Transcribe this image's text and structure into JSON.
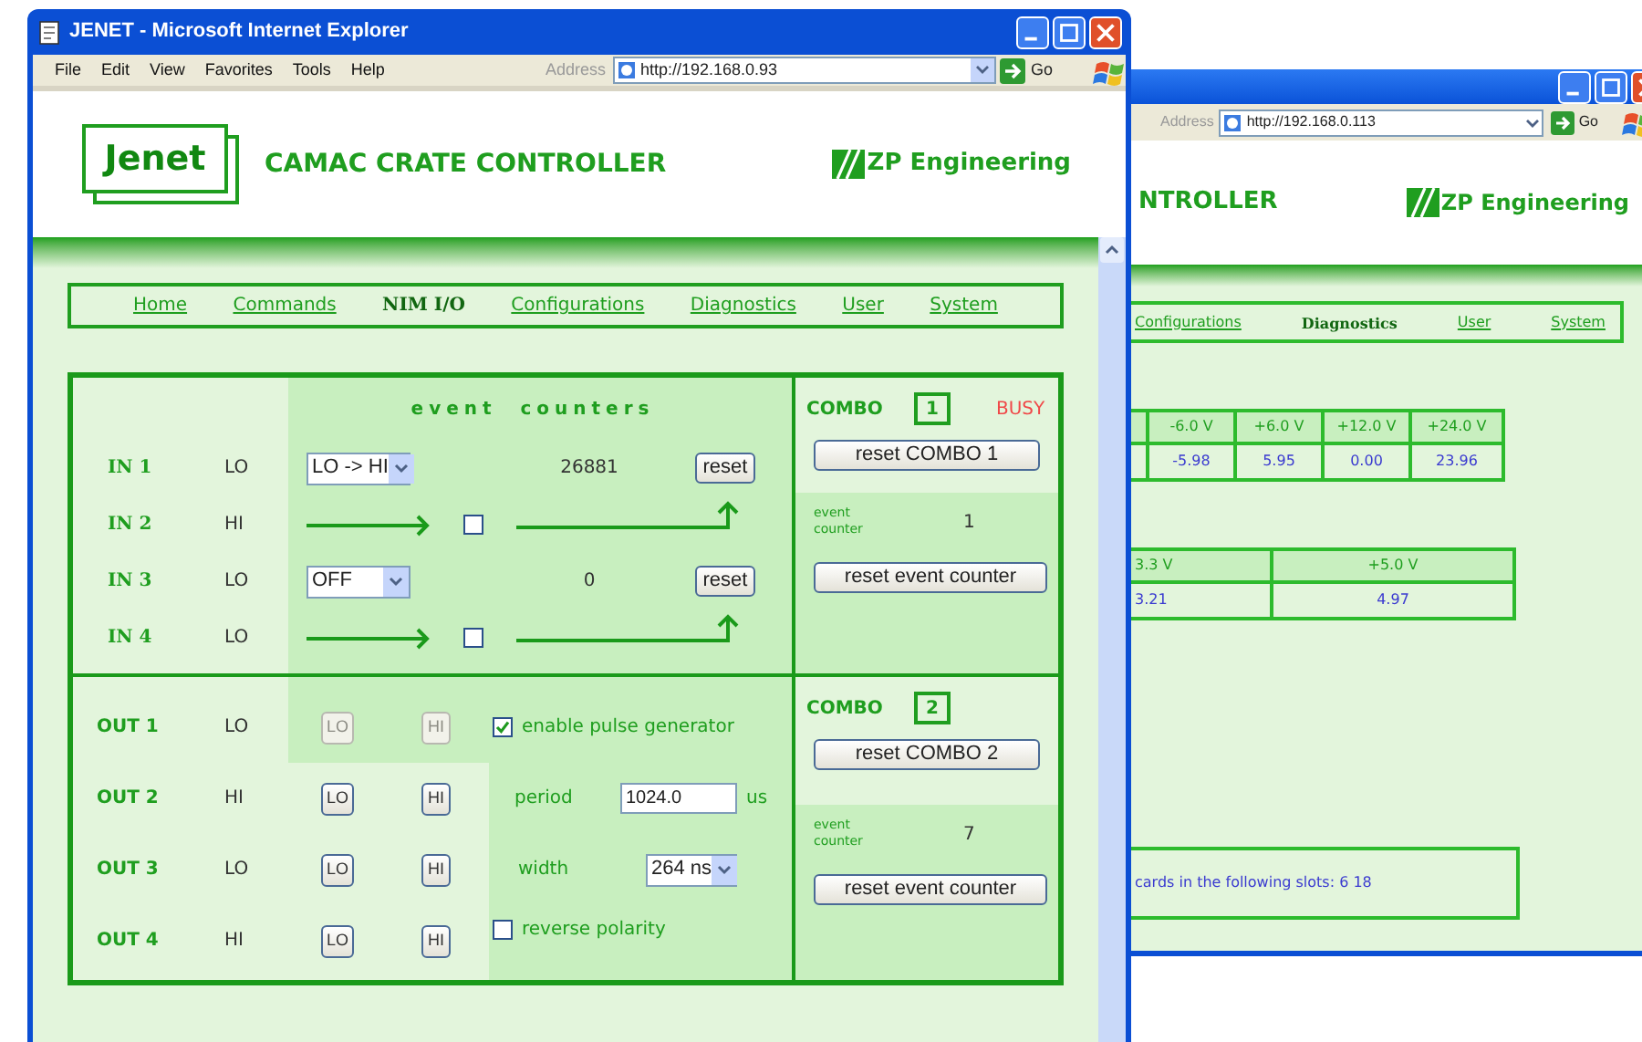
{
  "front_window": {
    "title": "JENET - Microsoft Internet Explorer",
    "menu": [
      "File",
      "Edit",
      "View",
      "Favorites",
      "Tools",
      "Help"
    ],
    "address_label": "Address",
    "url": "http://192.168.0.93",
    "go": "Go",
    "logo": "Jenet",
    "heading": "CAMAC CRATE CONTROLLER",
    "brand": "ZP Engineering",
    "nav": [
      {
        "label": "Home",
        "selected": false
      },
      {
        "label": "Commands",
        "selected": false
      },
      {
        "label": "NIM I/O",
        "selected": true
      },
      {
        "label": "Configurations",
        "selected": false
      },
      {
        "label": "Diagnostics",
        "selected": false
      },
      {
        "label": "User",
        "selected": false
      },
      {
        "label": "System",
        "selected": false
      }
    ],
    "event_counters_title": "event  counters",
    "inputs": [
      {
        "name": "IN 1",
        "state": "LO",
        "kind": "select",
        "mode": "LO -> HI",
        "count": "26881",
        "reset": "reset"
      },
      {
        "name": "IN 2",
        "state": "HI",
        "kind": "chain",
        "checked": false
      },
      {
        "name": "IN 3",
        "state": "LO",
        "kind": "select",
        "mode": "OFF",
        "count": "0",
        "reset": "reset"
      },
      {
        "name": "IN 4",
        "state": "LO",
        "kind": "chain",
        "checked": false
      }
    ],
    "outputs": [
      {
        "name": "OUT 1",
        "state": "LO",
        "lo": "LO",
        "hi": "HI",
        "disabled": true
      },
      {
        "name": "OUT 2",
        "state": "HI",
        "lo": "LO",
        "hi": "HI",
        "disabled": false
      },
      {
        "name": "OUT 3",
        "state": "LO",
        "lo": "LO",
        "hi": "HI",
        "disabled": false
      },
      {
        "name": "OUT 4",
        "state": "HI",
        "lo": "LO",
        "hi": "HI",
        "disabled": false
      }
    ],
    "pulse": {
      "enable": {
        "label": "enable pulse generator",
        "checked": true
      },
      "period_label": "period",
      "period": "1024.0",
      "period_unit": "us",
      "width_label": "width",
      "width": "264 ns",
      "reverse": {
        "label": "reverse polarity",
        "checked": false
      }
    },
    "combos": [
      {
        "label": "COMBO",
        "number": "1",
        "status": "BUSY",
        "reset": "reset COMBO 1",
        "counter_label": "event counter",
        "count": "1",
        "counter_reset": "reset event counter"
      },
      {
        "label": "COMBO",
        "number": "2",
        "reset": "reset COMBO 2",
        "counter_label": "event counter",
        "count": "7",
        "counter_reset": "reset event counter"
      }
    ]
  },
  "back_window": {
    "address_label": "Address",
    "url": "http://192.168.0.113",
    "go": "Go",
    "heading": "NTROLLER",
    "brand": "ZP Engineering",
    "nav": [
      {
        "label": "Configurations",
        "selected": false
      },
      {
        "label": "Diagnostics",
        "selected": true
      },
      {
        "label": "User",
        "selected": false
      },
      {
        "label": "System",
        "selected": false
      }
    ],
    "tables": [
      {
        "columns": [
          "-6.0 V",
          "+6.0 V",
          "+12.0 V",
          "+24.0 V"
        ],
        "values": [
          "-5.98",
          "5.95",
          "0.00",
          "23.96"
        ]
      },
      {
        "columns": [
          "3.3 V",
          "+5.0 V"
        ],
        "values": [
          "3.21",
          "4.97"
        ]
      }
    ],
    "message": "cards in the following slots: 6 18"
  }
}
